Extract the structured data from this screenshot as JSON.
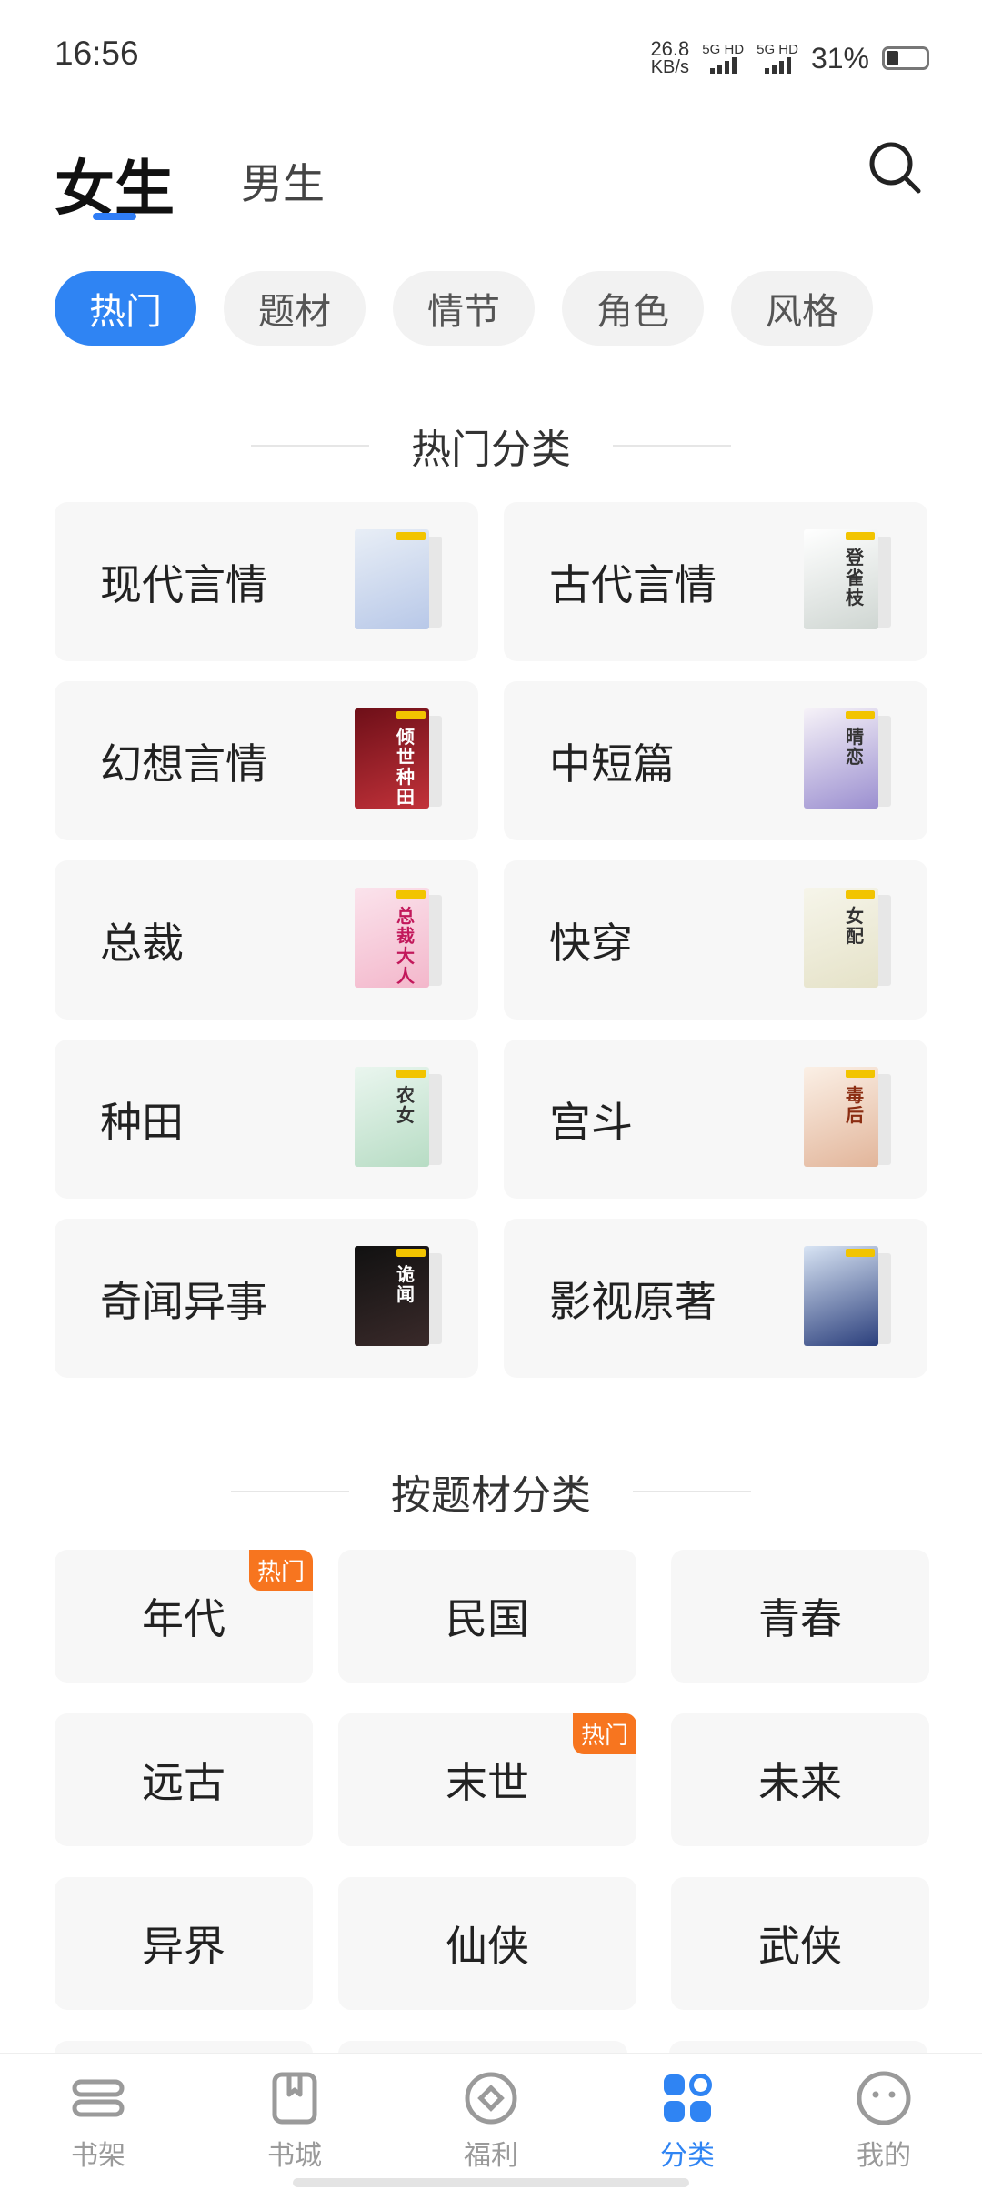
{
  "status_bar": {
    "time": "16:56",
    "net_speed_value": "26.8",
    "net_speed_unit": "KB/s",
    "sim1_label": "5G HD",
    "sim2_label": "5G HD",
    "battery_percent": "31%",
    "battery_level": 0.31
  },
  "header": {
    "tabs": [
      {
        "label": "女生",
        "active": true
      },
      {
        "label": "男生",
        "active": false
      }
    ],
    "search_icon": "search-icon"
  },
  "filter_chips": [
    {
      "label": "热门",
      "active": true
    },
    {
      "label": "题材",
      "active": false
    },
    {
      "label": "情节",
      "active": false
    },
    {
      "label": "角色",
      "active": false
    },
    {
      "label": "风格",
      "active": false
    }
  ],
  "hot_section": {
    "title": "热门分类",
    "categories": [
      {
        "label": "现代言情",
        "cover_title": "",
        "cover_colors": [
          "#e8eef6",
          "#b8c8e8"
        ]
      },
      {
        "label": "古代言情",
        "cover_title": "登雀枝",
        "cover_colors": [
          "#ffffff",
          "#cfd6d2"
        ]
      },
      {
        "label": "幻想言情",
        "cover_title": "倾世种田",
        "cover_colors": [
          "#6e0f18",
          "#c2323a"
        ]
      },
      {
        "label": "中短篇",
        "cover_title": "晴恋",
        "cover_colors": [
          "#f6f2f8",
          "#9b8fd0"
        ]
      },
      {
        "label": "总裁",
        "cover_title": "总裁大人",
        "cover_colors": [
          "#fbe3ec",
          "#f3b7cb"
        ]
      },
      {
        "label": "快穿",
        "cover_title": "女配",
        "cover_colors": [
          "#f6f5ea",
          "#e5e2c8"
        ]
      },
      {
        "label": "种田",
        "cover_title": "农女",
        "cover_colors": [
          "#eaf6ef",
          "#b7dcc4"
        ]
      },
      {
        "label": "宫斗",
        "cover_title": "毒后",
        "cover_colors": [
          "#fbf0e6",
          "#e2b59a"
        ]
      },
      {
        "label": "奇闻异事",
        "cover_title": "诡闻",
        "cover_colors": [
          "#111111",
          "#3a2a2a"
        ]
      },
      {
        "label": "影视原著",
        "cover_title": "",
        "cover_colors": [
          "#d8e4f4",
          "#2b3f7c"
        ]
      }
    ]
  },
  "topic_section": {
    "title": "按题材分类",
    "hot_badge_label": "热门",
    "topics": [
      {
        "label": "年代",
        "hot": true
      },
      {
        "label": "民国",
        "hot": false
      },
      {
        "label": "青春",
        "hot": false
      },
      {
        "label": "远古",
        "hot": false
      },
      {
        "label": "末世",
        "hot": true
      },
      {
        "label": "未来",
        "hot": false
      },
      {
        "label": "异界",
        "hot": false
      },
      {
        "label": "仙侠",
        "hot": false
      },
      {
        "label": "武侠",
        "hot": false
      }
    ]
  },
  "bottom_nav": [
    {
      "label": "书架",
      "icon": "bookshelf-icon",
      "active": false
    },
    {
      "label": "书城",
      "icon": "bookstore-icon",
      "active": false
    },
    {
      "label": "福利",
      "icon": "rewards-icon",
      "active": false
    },
    {
      "label": "分类",
      "icon": "category-icon",
      "active": true
    },
    {
      "label": "我的",
      "icon": "profile-icon",
      "active": false
    }
  ],
  "colors": {
    "accent": "#2f84f3",
    "hot_badge": "#f7751f",
    "card_bg": "#f7f7f7",
    "inactive_nav": "#9a9a9a"
  }
}
